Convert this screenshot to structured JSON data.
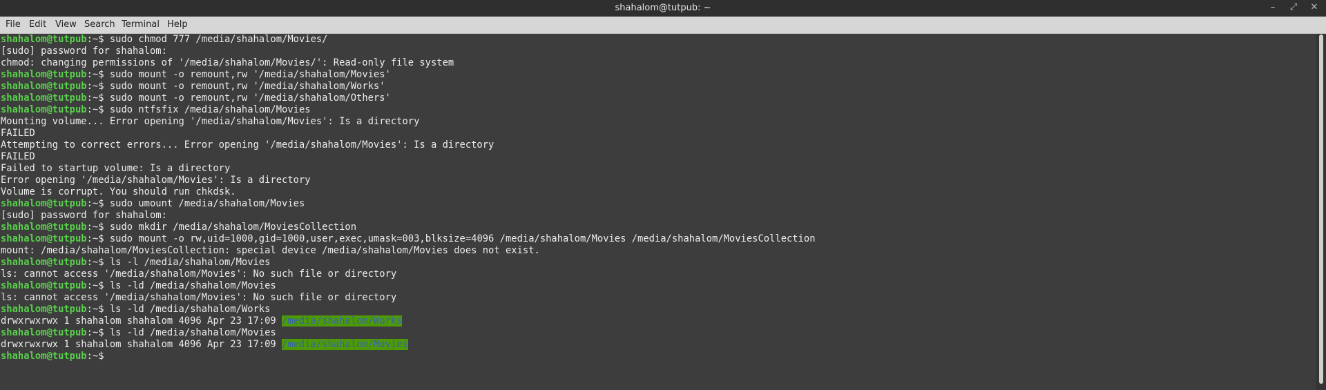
{
  "window": {
    "title": "shahalom@tutpub: ~",
    "minimize_glyph": "–",
    "maximize_glyph": "⤢",
    "close_glyph": "✕"
  },
  "menu": [
    "File",
    "Edit",
    "View",
    "Search",
    "Terminal",
    "Help"
  ],
  "prompt": {
    "user_host": "shahalom@tutpub",
    "path_sigil": ":~$"
  },
  "lines": [
    {
      "type": "cmd",
      "text": " sudo chmod 777 /media/shahalom/Movies/"
    },
    {
      "type": "out",
      "text": "[sudo] password for shahalom:"
    },
    {
      "type": "out",
      "text": "chmod: changing permissions of '/media/shahalom/Movies/': Read-only file system"
    },
    {
      "type": "cmd",
      "text": " sudo mount -o remount,rw '/media/shahalom/Movies'"
    },
    {
      "type": "cmd",
      "text": " sudo mount -o remount,rw '/media/shahalom/Works'"
    },
    {
      "type": "cmd",
      "text": " sudo mount -o remount,rw '/media/shahalom/Others'"
    },
    {
      "type": "cmd",
      "text": " sudo ntfsfix /media/shahalom/Movies"
    },
    {
      "type": "out",
      "text": "Mounting volume... Error opening '/media/shahalom/Movies': Is a directory"
    },
    {
      "type": "out",
      "text": "FAILED"
    },
    {
      "type": "out",
      "text": "Attempting to correct errors... Error opening '/media/shahalom/Movies': Is a directory"
    },
    {
      "type": "out",
      "text": "FAILED"
    },
    {
      "type": "out",
      "text": "Failed to startup volume: Is a directory"
    },
    {
      "type": "out",
      "text": "Error opening '/media/shahalom/Movies': Is a directory"
    },
    {
      "type": "out",
      "text": "Volume is corrupt. You should run chkdsk."
    },
    {
      "type": "cmd",
      "text": " sudo umount /media/shahalom/Movies"
    },
    {
      "type": "out",
      "text": "[sudo] password for shahalom:"
    },
    {
      "type": "cmd",
      "text": " sudo mkdir /media/shahalom/MoviesCollection"
    },
    {
      "type": "cmd",
      "text": " sudo mount -o rw,uid=1000,gid=1000,user,exec,umask=003,blksize=4096 /media/shahalom/Movies /media/shahalom/MoviesCollection"
    },
    {
      "type": "out",
      "text": "mount: /media/shahalom/MoviesCollection: special device /media/shahalom/Movies does not exist."
    },
    {
      "type": "cmd",
      "text": " ls -l /media/shahalom/Movies"
    },
    {
      "type": "out",
      "text": "ls: cannot access '/media/shahalom/Movies': No such file or directory"
    },
    {
      "type": "cmd",
      "text": " ls -ld /media/shahalom/Movies"
    },
    {
      "type": "out",
      "text": "ls: cannot access '/media/shahalom/Movies': No such file or directory"
    },
    {
      "type": "cmd",
      "text": " ls -ld /media/shahalom/Works"
    },
    {
      "type": "ls",
      "text": "drwxrwxrwx 1 shahalom shahalom 4096 Apr 23 17:09 ",
      "hl": "/media/shahalom/Works"
    },
    {
      "type": "cmd",
      "text": " ls -ld /media/shahalom/Movies"
    },
    {
      "type": "ls",
      "text": "drwxrwxrwx 1 shahalom shahalom 4096 Apr 23 17:09 ",
      "hl": "/media/shahalom/Movies"
    },
    {
      "type": "cmd",
      "text": ""
    }
  ],
  "colors": {
    "prompt_user": "#58d04b",
    "path_highlight_bg": "#4e9a06",
    "path_highlight_fg": "#3465a4",
    "terminal_bg": "#3d3d3d",
    "terminal_fg": "#ececec"
  }
}
